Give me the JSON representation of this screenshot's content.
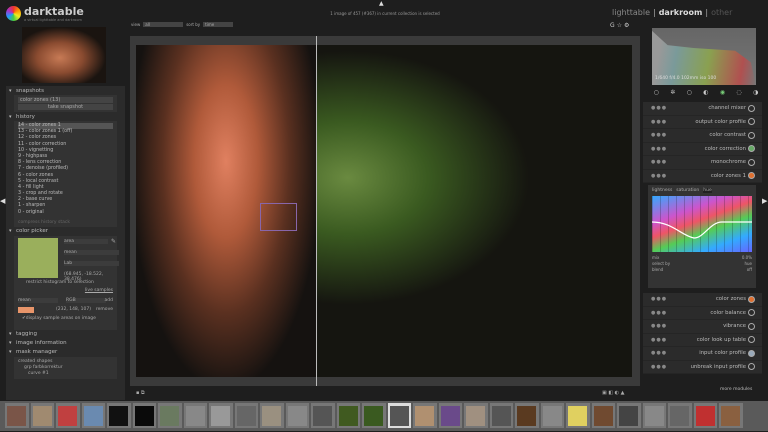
{
  "app": {
    "name": "darktable",
    "subtitle": "a virtual lighttable and darkroom",
    "collection_status": "1 image of 457 (#367) in current collection is selected"
  },
  "views": {
    "lighttable": "lighttable",
    "darkroom": "darkroom",
    "other": "other",
    "sep": "|"
  },
  "filter": {
    "view_label": "view",
    "view_value": "all",
    "sort_label": "sort by",
    "sort_value": "time"
  },
  "snapshots": {
    "title": "snapshots",
    "item": "color zones (13)",
    "button": "take snapshot"
  },
  "history": {
    "title": "history",
    "items": [
      "14 - color zones 1",
      "13 - color zones 1 (off)",
      "12 - color zones",
      "11 - color correction",
      "10 - vignetting",
      "9 - highpass",
      "8 - lens correction",
      "7 - denoise (profiled)",
      "6 - color zones",
      "5 - local contrast",
      "4 - fill light",
      "3 - crop and rotate",
      "2 - base curve",
      "1 - sharpen",
      "0 - original"
    ],
    "compress": "compress history stack"
  },
  "color_picker": {
    "title": "color picker",
    "swatch": "#9aaf5c",
    "mode": "area",
    "stat": "mean",
    "space": "Lab",
    "values": "(68.945, -18.522, 38.476)",
    "restrict": "restrict histogram to selection",
    "live": "live samples",
    "sample_stat": "mean",
    "sample_space": "RGB",
    "add": "add",
    "sample_swatch": "#e8956a",
    "sample_values": "(232, 148, 107)",
    "remove": "remove",
    "display": "display sample areas on image"
  },
  "collapsed": [
    "tagging",
    "image information"
  ],
  "mask_manager": {
    "title": "mask manager",
    "created": "created shapes",
    "group": "grp farbkorrektur",
    "curve": "curve #1"
  },
  "histogram": {
    "exif": "1/640 f/4.0 102mm iso 100"
  },
  "modules": {
    "top": [
      {
        "name": "channel mixer"
      },
      {
        "name": "output color profile"
      },
      {
        "name": "color contrast"
      },
      {
        "name": "color correction",
        "icon": "#6a6"
      },
      {
        "name": "monochrome"
      },
      {
        "name": "color zones 1",
        "icon": "#e07030"
      }
    ],
    "bottom": [
      {
        "name": "color zones",
        "icon": "#e07030"
      },
      {
        "name": "color balance"
      },
      {
        "name": "vibrance"
      },
      {
        "name": "color look up table"
      },
      {
        "name": "input color profile",
        "icon": "#9ab"
      },
      {
        "name": "unbreak input profile"
      }
    ],
    "more": "more modules"
  },
  "colorzones": {
    "tabs": [
      "lightness",
      "saturation",
      "hue"
    ],
    "mix_label": "mix",
    "mix_value": "0.0%",
    "select_label": "select by",
    "select_value": "hue",
    "blend_label": "blend",
    "blend_value": "off"
  },
  "filmstrip": [
    "#7a5548",
    "#a08a70",
    "#c04040",
    "#6a8ab0",
    "#111",
    "#0a0a0a",
    "#6a7a60",
    "#888",
    "#999",
    "#666",
    "#9a9080",
    "#888",
    "#555",
    "#405a20",
    "#3a5a20",
    "#555",
    "#b09070",
    "#6a4a8a",
    "#a09080",
    "#555",
    "#5a3a20",
    "#888",
    "#e0d060",
    "#704a30",
    "#444",
    "#888",
    "#666",
    "#c03030",
    "#8a6040"
  ]
}
